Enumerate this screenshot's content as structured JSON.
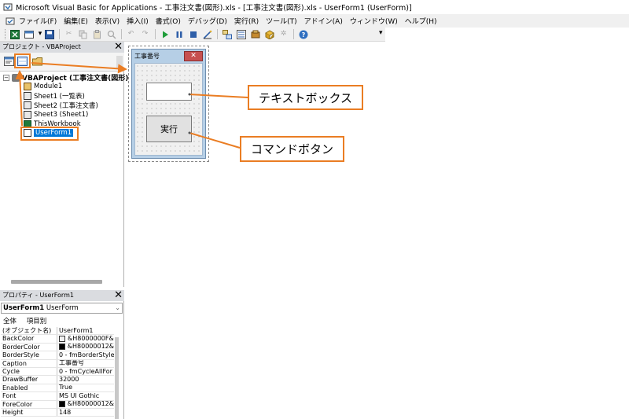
{
  "window": {
    "title": "Microsoft Visual Basic for Applications - 工事注文書(図形).xls - [工事注文書(図形).xls - UserForm1 (UserForm)]"
  },
  "menubar": {
    "items": [
      "ファイル(F)",
      "編集(E)",
      "表示(V)",
      "挿入(I)",
      "書式(O)",
      "デバッグ(D)",
      "実行(R)",
      "ツール(T)",
      "アドイン(A)",
      "ウィンドウ(W)",
      "ヘルプ(H)"
    ]
  },
  "toolbar": {
    "icons": [
      "excel-view-icon",
      "insert-userform-icon",
      "save-icon",
      "cut-icon",
      "copy-icon",
      "paste-icon",
      "find-icon",
      "undo-icon",
      "redo-icon",
      "run-icon",
      "break-icon",
      "reset-icon",
      "design-mode-icon",
      "project-explorer-icon",
      "properties-window-icon",
      "object-browser-icon",
      "toolbox-icon",
      "help-icon"
    ]
  },
  "project_panel": {
    "title": "プロジェクト - VBAProject",
    "root": "VBAProject (工事注文書(図形)",
    "items": [
      {
        "label": "Module1",
        "icon": "module-icon"
      },
      {
        "label": "Sheet1 (一覧表)",
        "icon": "sheet-icon"
      },
      {
        "label": "Sheet2 (工事注文書)",
        "icon": "sheet-icon"
      },
      {
        "label": "Sheet3 (Sheet1)",
        "icon": "sheet-icon"
      },
      {
        "label": "ThisWorkbook",
        "icon": "workbook-icon"
      },
      {
        "label": "UserForm1",
        "icon": "userform-icon",
        "selected": true
      }
    ]
  },
  "properties_panel": {
    "title": "プロパティ - UserForm1",
    "object_name": "UserForm1",
    "object_type": "UserForm",
    "tabs": [
      "全体",
      "項目別"
    ],
    "rows": [
      {
        "name": "(オブジェクト名)",
        "value": "UserForm1"
      },
      {
        "name": "BackColor",
        "value": "&H8000000F&",
        "swatch": "#f0f0f0"
      },
      {
        "name": "BorderColor",
        "value": "&H80000012&",
        "swatch": "#000000"
      },
      {
        "name": "BorderStyle",
        "value": "0 - fmBorderStyle"
      },
      {
        "name": "Caption",
        "value": "工事番号"
      },
      {
        "name": "Cycle",
        "value": "0 - fmCycleAllFor"
      },
      {
        "name": "DrawBuffer",
        "value": "32000"
      },
      {
        "name": "Enabled",
        "value": "True"
      },
      {
        "name": "Font",
        "value": "MS UI Gothic"
      },
      {
        "name": "ForeColor",
        "value": "&H80000012&",
        "swatch": "#000000"
      },
      {
        "name": "Height",
        "value": "148"
      }
    ]
  },
  "userform": {
    "caption": "工事番号",
    "close_glyph": "✕",
    "button_label": "実行"
  },
  "annotations": {
    "textbox_label": "テキストボックス",
    "button_label": "コマンドボタン",
    "accent_color": "#ea7d23"
  }
}
